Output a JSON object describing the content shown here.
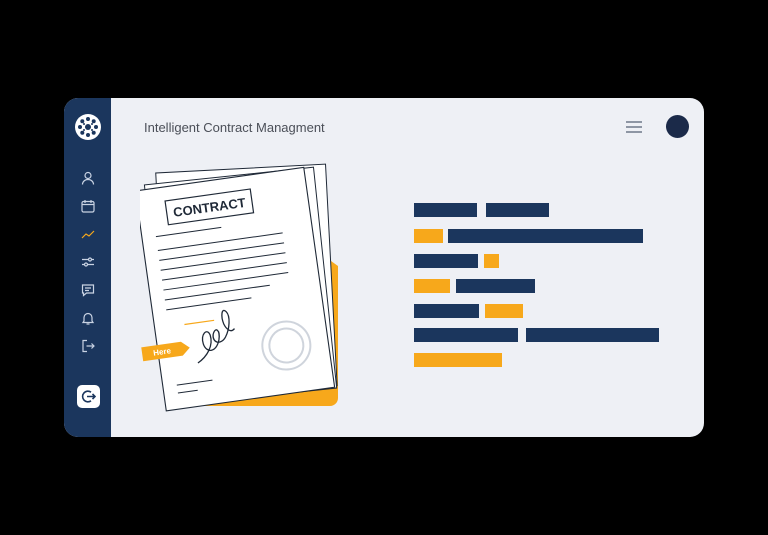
{
  "app": {
    "title": "Intelligent Contract Managment"
  },
  "sidebar": {
    "items": [
      {
        "icon": "user-icon"
      },
      {
        "icon": "calendar-icon"
      },
      {
        "icon": "analytics-icon"
      },
      {
        "icon": "sliders-icon"
      },
      {
        "icon": "chat-icon"
      },
      {
        "icon": "bell-icon"
      },
      {
        "icon": "exit-icon"
      }
    ],
    "logout_icon": "logout-icon"
  },
  "illustration": {
    "document_heading": "CONTRACT",
    "sign_tag": "Here"
  },
  "colors": {
    "sidebar": "#1b365d",
    "accent": "#f7a81b",
    "background": "#eef0f5",
    "navy_bar": "#1b365d"
  }
}
